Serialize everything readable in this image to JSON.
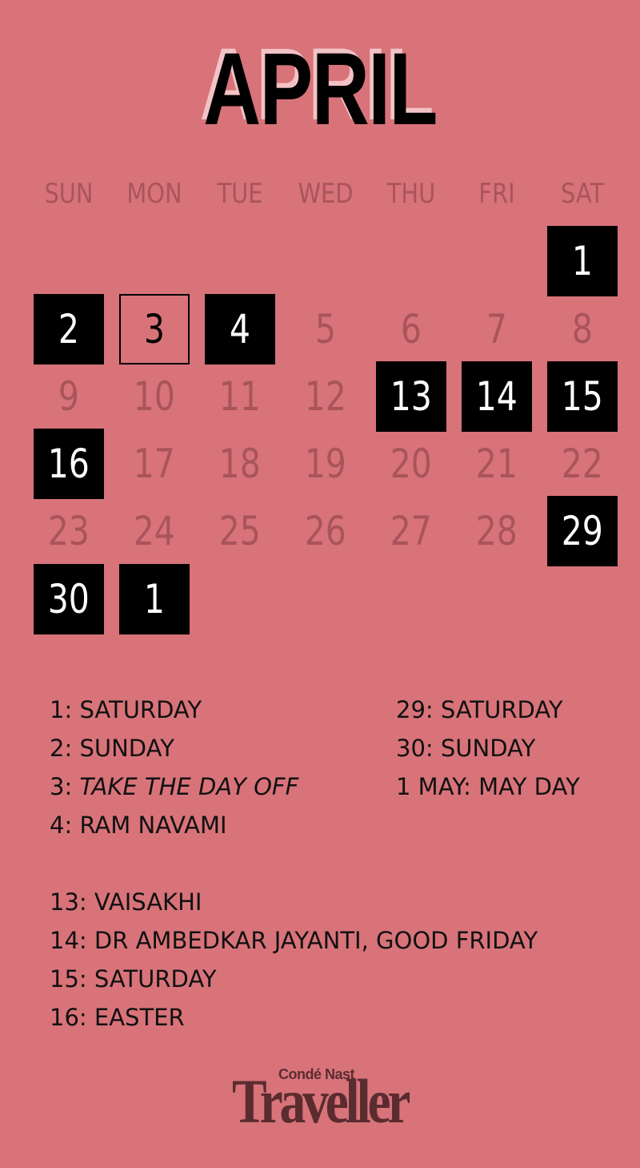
{
  "month": "APRIL",
  "weekdays": [
    "SUN",
    "MON",
    "TUE",
    "WED",
    "THU",
    "FRI",
    "SAT"
  ],
  "days": [
    {
      "label": "1",
      "style": "holiday"
    },
    {
      "label": "2",
      "style": "holiday"
    },
    {
      "label": "3",
      "style": "outline"
    },
    {
      "label": "4",
      "style": "holiday"
    },
    {
      "label": "5",
      "style": "normal"
    },
    {
      "label": "6",
      "style": "normal"
    },
    {
      "label": "7",
      "style": "normal"
    },
    {
      "label": "8",
      "style": "normal"
    },
    {
      "label": "9",
      "style": "normal"
    },
    {
      "label": "10",
      "style": "normal"
    },
    {
      "label": "11",
      "style": "normal"
    },
    {
      "label": "12",
      "style": "normal"
    },
    {
      "label": "13",
      "style": "holiday"
    },
    {
      "label": "14",
      "style": "holiday"
    },
    {
      "label": "15",
      "style": "holiday"
    },
    {
      "label": "16",
      "style": "holiday"
    },
    {
      "label": "17",
      "style": "normal"
    },
    {
      "label": "18",
      "style": "normal"
    },
    {
      "label": "19",
      "style": "normal"
    },
    {
      "label": "20",
      "style": "normal"
    },
    {
      "label": "21",
      "style": "normal"
    },
    {
      "label": "22",
      "style": "normal"
    },
    {
      "label": "23",
      "style": "normal"
    },
    {
      "label": "24",
      "style": "normal"
    },
    {
      "label": "25",
      "style": "normal"
    },
    {
      "label": "26",
      "style": "normal"
    },
    {
      "label": "27",
      "style": "normal"
    },
    {
      "label": "28",
      "style": "normal"
    },
    {
      "label": "29",
      "style": "holiday"
    },
    {
      "label": "30",
      "style": "holiday"
    },
    {
      "label": "1",
      "style": "holiday"
    }
  ],
  "notes_left": [
    {
      "day": "1:",
      "text": "SATURDAY",
      "italic": false
    },
    {
      "day": "2:",
      "text": "SUNDAY",
      "italic": false
    },
    {
      "day": "3:",
      "text": "TAKE THE DAY OFF",
      "italic": true
    },
    {
      "day": "4:",
      "text": "RAM NAVAMI",
      "italic": false
    },
    null,
    {
      "day": "13:",
      "text": "VAISAKHI",
      "italic": false
    },
    {
      "day": "14:",
      "text": "DR AMBEDKAR JAYANTI, GOOD FRIDAY",
      "italic": false
    },
    {
      "day": "15:",
      "text": "SATURDAY",
      "italic": false
    },
    {
      "day": "16:",
      "text": "EASTER",
      "italic": false
    }
  ],
  "notes_right": [
    {
      "day": "29:",
      "text": "SATURDAY",
      "italic": false
    },
    {
      "day": "30:",
      "text": "SUNDAY",
      "italic": false
    },
    {
      "day": "1 MAY:",
      "text": "MAY DAY",
      "italic": false
    }
  ],
  "logo": {
    "top": "Condé Nast",
    "main": "Traveller"
  },
  "colors": {
    "background": "#d8737a",
    "muted": "#a9545b",
    "box": "#000000",
    "logo": "#5a2c30"
  }
}
